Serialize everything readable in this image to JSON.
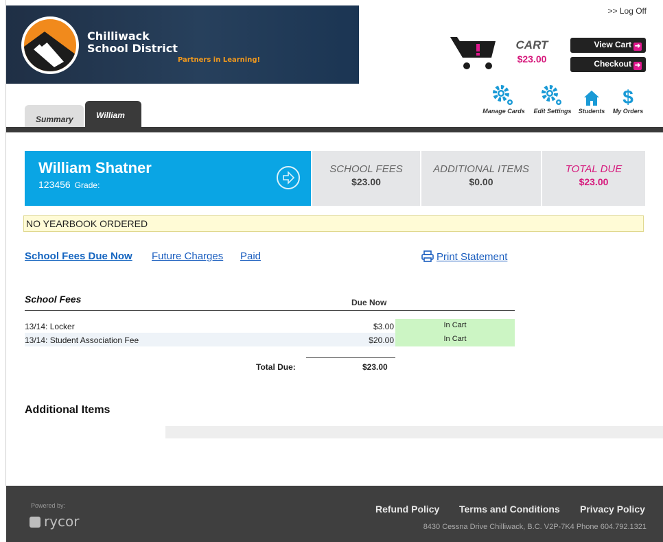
{
  "header": {
    "district_line1": "Chilliwack",
    "district_line2": "School District",
    "tagline": "Partners in Learning!",
    "logoff": ">> Log Off"
  },
  "cart": {
    "label": "CART",
    "total": "$23.00",
    "view_cart": "View Cart",
    "checkout": "Checkout"
  },
  "tools": [
    {
      "label": "Manage Cards",
      "icon": "gear-icon"
    },
    {
      "label": "Edit Settings",
      "icon": "gear-icon"
    },
    {
      "label": "Students",
      "icon": "house-icon"
    },
    {
      "label": "My Orders",
      "icon": "dollar-icon"
    }
  ],
  "tabs": [
    "Summary",
    "William"
  ],
  "student": {
    "name": "William Shatner",
    "id": "123456",
    "grade_label": "Grade:"
  },
  "summary": {
    "school_fees_label": "SCHOOL FEES",
    "school_fees_value": "$23.00",
    "additional_label": "ADDITIONAL ITEMS",
    "additional_value": "$0.00",
    "total_label": "TOTAL DUE",
    "total_value": "$23.00"
  },
  "notice": "NO YEARBOOK ORDERED",
  "subtabs": [
    "School Fees Due Now",
    "Future Charges",
    "Paid"
  ],
  "print_label": "Print Statement",
  "fees": {
    "title": "School Fees",
    "due_header": "Due Now",
    "rows": [
      {
        "desc": "13/14: Locker",
        "amount": "$3.00",
        "status": "In Cart"
      },
      {
        "desc": "13/14: Student Association Fee",
        "amount": "$20.00",
        "status": "In Cart"
      }
    ],
    "total_label": "Total Due:",
    "total_value": "$23.00"
  },
  "additional_title": "Additional Items",
  "footer": {
    "powered_by": "Powered by:",
    "brand": "rycor",
    "links": [
      "Refund Policy",
      "Terms and Conditions",
      "Privacy Policy"
    ],
    "address": "8430 Cessna Drive Chilliwack, B.C. V2P-7K4 Phone 604.792.1321"
  },
  "colors": {
    "accent_blue": "#0aa5e4",
    "accent_pink": "#d6197c",
    "banner_navy": "#1f2f45",
    "in_cart_green": "#ccf5c4"
  }
}
